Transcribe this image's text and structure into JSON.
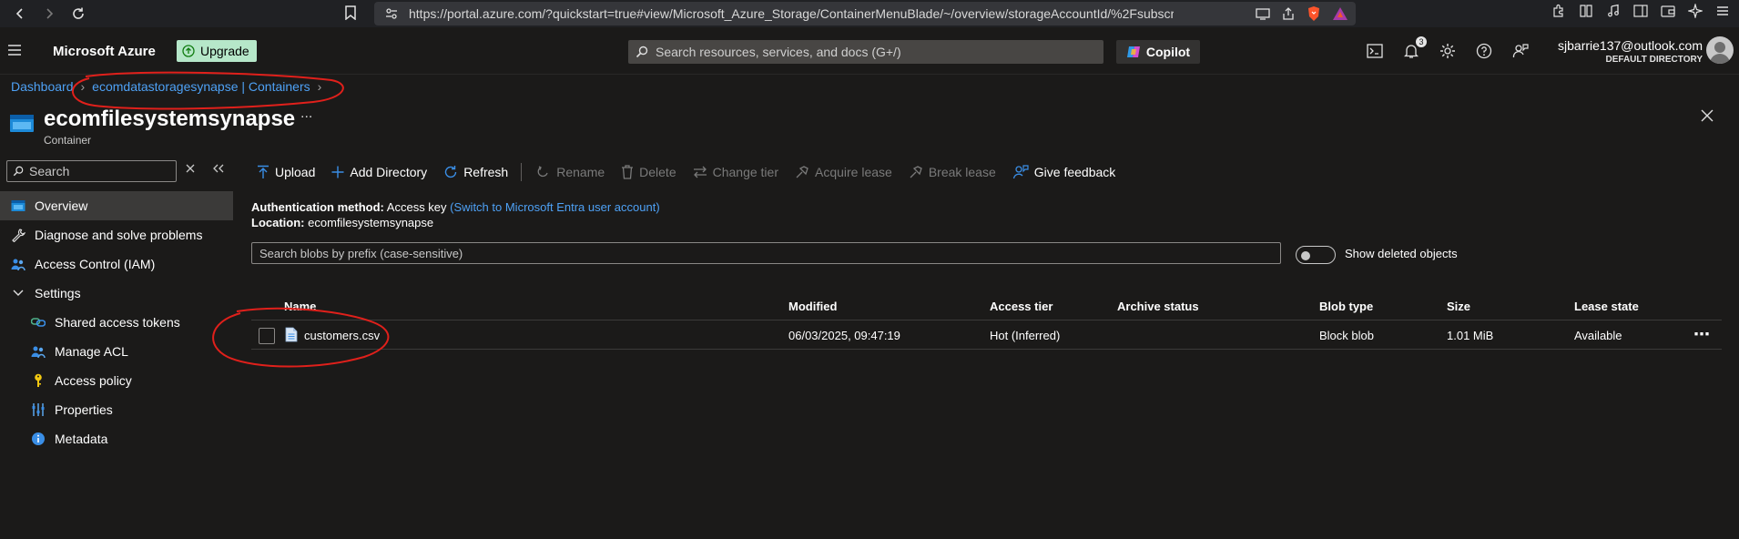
{
  "browser": {
    "url": "https://portal.azure.com/?quickstart=true#view/Microsoft_Azure_Storage/ContainerMenuBlade/~/overview/storageAccountId/%2Fsubscription..."
  },
  "topbar": {
    "brand": "Microsoft Azure",
    "upgrade_label": "Upgrade",
    "search_placeholder": "Search resources, services, and docs (G+/)",
    "copilot_label": "Copilot",
    "notification_count": "3",
    "account_email": "sjbarrie137@outlook.com",
    "account_directory": "DEFAULT DIRECTORY"
  },
  "breadcrumb": {
    "items": [
      "Dashboard",
      "ecomdatastoragesynapse | Containers"
    ]
  },
  "page": {
    "title": "ecomfilesystemsynapse",
    "subtitle": "Container",
    "more": "..."
  },
  "sidebar": {
    "search_placeholder": "Search",
    "items": [
      {
        "label": "Overview",
        "icon": "overview-icon"
      },
      {
        "label": "Diagnose and solve problems",
        "icon": "wrench-icon"
      },
      {
        "label": "Access Control (IAM)",
        "icon": "people-icon"
      },
      {
        "label": "Settings",
        "icon": "chevron-down-icon"
      },
      {
        "label": "Shared access tokens",
        "icon": "link-icon"
      },
      {
        "label": "Manage ACL",
        "icon": "people-icon"
      },
      {
        "label": "Access policy",
        "icon": "key-icon"
      },
      {
        "label": "Properties",
        "icon": "properties-icon"
      },
      {
        "label": "Metadata",
        "icon": "info-icon"
      }
    ]
  },
  "toolbar": {
    "upload": "Upload",
    "add_directory": "Add Directory",
    "refresh": "Refresh",
    "rename": "Rename",
    "delete": "Delete",
    "change_tier": "Change tier",
    "acquire_lease": "Acquire lease",
    "break_lease": "Break lease",
    "give_feedback": "Give feedback"
  },
  "auth": {
    "method_label": "Authentication method:",
    "method_value": "Access key",
    "switch_link": "(Switch to Microsoft Entra user account)",
    "location_label": "Location:",
    "location_value": "ecomfilesystemsynapse"
  },
  "blob_search": {
    "placeholder": "Search blobs by prefix (case-sensitive)",
    "show_deleted_label": "Show deleted objects"
  },
  "table": {
    "columns": [
      "Name",
      "Modified",
      "Access tier",
      "Archive status",
      "Blob type",
      "Size",
      "Lease state"
    ],
    "rows": [
      {
        "name": "customers.csv",
        "modified": "06/03/2025, 09:47:19",
        "access_tier": "Hot (Inferred)",
        "archive_status": "",
        "blob_type": "Block blob",
        "size": "1.01 MiB",
        "lease_state": "Available"
      }
    ]
  },
  "colors": {
    "link": "#4ea1f5",
    "annotation": "#e0201b",
    "upgrade_bg": "#b6e7c9"
  }
}
